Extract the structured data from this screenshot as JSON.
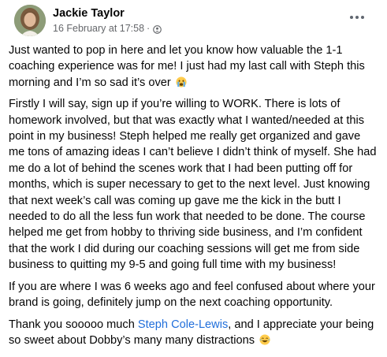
{
  "post": {
    "author": "Jackie Taylor",
    "timestamp": "16 February at 17:58",
    "separator": "·",
    "privacy_icon": "friends-icon",
    "more_icon": "more-options-icon",
    "paragraphs": [
      {
        "text": "Just wanted to pop in here and let you know how valuable the 1-1 coaching experience was for me! I just had my last call with Steph this morning and I’m so sad it’s over",
        "emoji": "crying-face-emoji"
      },
      {
        "text": "Firstly I will say, sign up if you’re willing to WORK. There is lots of homework involved, but that was exactly what I wanted/needed at this point in my business! Steph helped me really get organized and gave me tons of amazing ideas I can’t believe I didn’t think of myself. She had me do a lot of behind the scenes work that I had been putting off for months, which is super necessary to get to the next level. Just knowing that next week’s call was coming up gave me the kick in the butt I needed to do all the less fun work that needed to be done. The course helped me get from hobby to thriving side business, and I’m confident that the work I did during our coaching sessions will get me from side business to quitting my 9-5 and going full time with my business!"
      },
      {
        "text": "If you are where I was 6 weeks ago and feel confused about where your brand is going, definitely jump on the next coaching opportunity."
      },
      {
        "before_link": "Thank you sooooo much ",
        "link": "Steph Cole-Lewis",
        "after_link": ", and I appreciate your being so sweet about Dobby’s many many distractions",
        "emoji": "laughing-face-emoji"
      }
    ],
    "colors": {
      "text": "#050505",
      "secondary": "#65676b",
      "link": "#216fdb"
    }
  }
}
